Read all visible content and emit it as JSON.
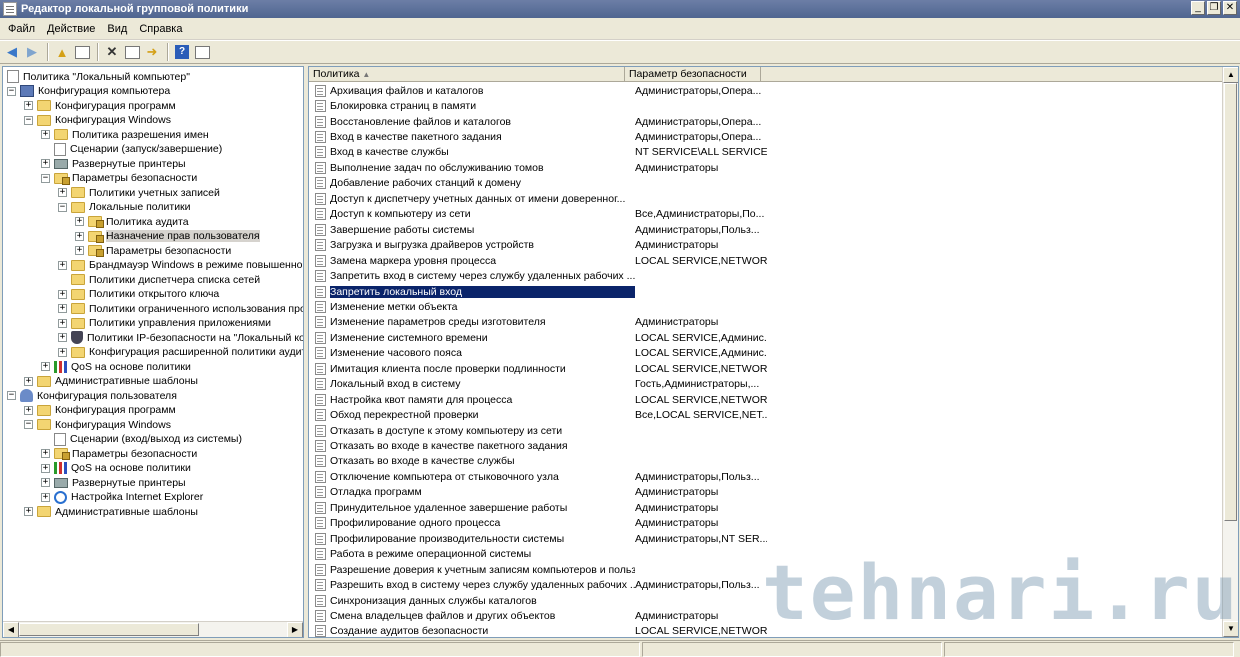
{
  "window": {
    "title": "Редактор локальной групповой политики",
    "controls": [
      "_",
      "❐",
      "✕"
    ]
  },
  "menu": [
    "Файл",
    "Действие",
    "Вид",
    "Справка"
  ],
  "toolbar": [
    "back-icon",
    "forward-icon",
    "up-icon",
    "show-hide-tree-icon",
    "delete-icon",
    "properties-icon",
    "export-icon",
    "help-icon",
    "console-icon"
  ],
  "tree": [
    {
      "label": "Политика \"Локальный компьютер\"",
      "level": 0,
      "exp": "",
      "icon": "doc"
    },
    {
      "label": "Конфигурация компьютера",
      "level": 0,
      "exp": "−",
      "icon": "pc"
    },
    {
      "label": "Конфигурация программ",
      "level": 1,
      "exp": "+",
      "icon": "folder"
    },
    {
      "label": "Конфигурация Windows",
      "level": 1,
      "exp": "−",
      "icon": "folder"
    },
    {
      "label": "Политика разрешения имен",
      "level": 2,
      "exp": "+",
      "icon": "folder"
    },
    {
      "label": "Сценарии (запуск/завершение)",
      "level": 2,
      "exp": "",
      "icon": "doc"
    },
    {
      "label": "Развернутые принтеры",
      "level": 2,
      "exp": "+",
      "icon": "printer"
    },
    {
      "label": "Параметры безопасности",
      "level": 2,
      "exp": "−",
      "icon": "folder-lock"
    },
    {
      "label": "Политики учетных записей",
      "level": 3,
      "exp": "+",
      "icon": "folder"
    },
    {
      "label": "Локальные политики",
      "level": 3,
      "exp": "−",
      "icon": "folder"
    },
    {
      "label": "Политика аудита",
      "level": 4,
      "exp": "+",
      "icon": "folder-lock"
    },
    {
      "label": "Назначение прав пользователя",
      "level": 4,
      "exp": "+",
      "icon": "folder-lock",
      "selected": true
    },
    {
      "label": "Параметры безопасности",
      "level": 4,
      "exp": "+",
      "icon": "folder-lock"
    },
    {
      "label": "Брандмауэр Windows в режиме повышенной б",
      "level": 3,
      "exp": "+",
      "icon": "folder"
    },
    {
      "label": "Политики диспетчера списка сетей",
      "level": 3,
      "exp": "",
      "icon": "folder"
    },
    {
      "label": "Политики открытого ключа",
      "level": 3,
      "exp": "+",
      "icon": "folder"
    },
    {
      "label": "Политики ограниченного использования прог",
      "level": 3,
      "exp": "+",
      "icon": "folder"
    },
    {
      "label": "Политики управления приложениями",
      "level": 3,
      "exp": "+",
      "icon": "folder"
    },
    {
      "label": "Политики IP-безопасности на \"Локальный ког",
      "level": 3,
      "exp": "+",
      "icon": "shield"
    },
    {
      "label": "Конфигурация расширенной политики аудита",
      "level": 3,
      "exp": "+",
      "icon": "folder"
    },
    {
      "label": "QoS на основе политики",
      "level": 2,
      "exp": "+",
      "icon": "chart"
    },
    {
      "label": "Административные шаблоны",
      "level": 1,
      "exp": "+",
      "icon": "folder"
    },
    {
      "label": "Конфигурация пользователя",
      "level": 0,
      "exp": "−",
      "icon": "user"
    },
    {
      "label": "Конфигурация программ",
      "level": 1,
      "exp": "+",
      "icon": "folder"
    },
    {
      "label": "Конфигурация Windows",
      "level": 1,
      "exp": "−",
      "icon": "folder"
    },
    {
      "label": "Сценарии (вход/выход из системы)",
      "level": 2,
      "exp": "",
      "icon": "doc"
    },
    {
      "label": "Параметры безопасности",
      "level": 2,
      "exp": "+",
      "icon": "folder-lock"
    },
    {
      "label": "QoS на основе политики",
      "level": 2,
      "exp": "+",
      "icon": "chart"
    },
    {
      "label": "Развернутые принтеры",
      "level": 2,
      "exp": "+",
      "icon": "printer"
    },
    {
      "label": "Настройка Internet Explorer",
      "level": 2,
      "exp": "+",
      "icon": "ie"
    },
    {
      "label": "Административные шаблоны",
      "level": 1,
      "exp": "+",
      "icon": "folder"
    }
  ],
  "columns": {
    "policy": "Политика",
    "setting": "Параметр безопасности"
  },
  "policies": [
    {
      "name": "Архивация файлов и каталогов",
      "value": "Администраторы,Опера..."
    },
    {
      "name": "Блокировка страниц в памяти",
      "value": ""
    },
    {
      "name": "Восстановление файлов и каталогов",
      "value": "Администраторы,Опера..."
    },
    {
      "name": "Вход в качестве пакетного задания",
      "value": "Администраторы,Опера..."
    },
    {
      "name": "Вход в качестве службы",
      "value": "NT SERVICE\\ALL SERVICES"
    },
    {
      "name": "Выполнение задач по обслуживанию томов",
      "value": "Администраторы"
    },
    {
      "name": "Добавление рабочих станций к домену",
      "value": ""
    },
    {
      "name": "Доступ к диспетчеру учетных данных от имени доверенног...",
      "value": ""
    },
    {
      "name": "Доступ к компьютеру из сети",
      "value": "Все,Администраторы,По..."
    },
    {
      "name": "Завершение работы системы",
      "value": "Администраторы,Польз..."
    },
    {
      "name": "Загрузка и выгрузка драйверов устройств",
      "value": "Администраторы"
    },
    {
      "name": "Замена маркера уровня процесса",
      "value": "LOCAL SERVICE,NETWOR..."
    },
    {
      "name": "Запретить вход в систему через службу удаленных рабочих ...",
      "value": ""
    },
    {
      "name": "Запретить локальный вход",
      "value": "",
      "selected": true
    },
    {
      "name": "Изменение метки объекта",
      "value": ""
    },
    {
      "name": "Изменение параметров среды изготовителя",
      "value": "Администраторы"
    },
    {
      "name": "Изменение системного времени",
      "value": "LOCAL SERVICE,Админис..."
    },
    {
      "name": "Изменение часового пояса",
      "value": "LOCAL SERVICE,Админис..."
    },
    {
      "name": "Имитация клиента после проверки подлинности",
      "value": "LOCAL SERVICE,NETWOR..."
    },
    {
      "name": "Локальный вход в систему",
      "value": "Гость,Администраторы,..."
    },
    {
      "name": "Настройка квот памяти для процесса",
      "value": "LOCAL SERVICE,NETWOR..."
    },
    {
      "name": "Обход перекрестной проверки",
      "value": "Все,LOCAL SERVICE,NET..."
    },
    {
      "name": "Отказать в доступе к этому компьютеру из сети",
      "value": ""
    },
    {
      "name": "Отказать во входе в качестве пакетного задания",
      "value": ""
    },
    {
      "name": "Отказать во входе в качестве службы",
      "value": ""
    },
    {
      "name": "Отключение компьютера от стыковочного узла",
      "value": "Администраторы,Польз..."
    },
    {
      "name": "Отладка программ",
      "value": "Администраторы"
    },
    {
      "name": "Принудительное удаленное завершение работы",
      "value": "Администраторы"
    },
    {
      "name": "Профилирование одного процесса",
      "value": "Администраторы"
    },
    {
      "name": "Профилирование производительности системы",
      "value": "Администраторы,NT SER..."
    },
    {
      "name": "Работа в режиме операционной системы",
      "value": ""
    },
    {
      "name": "Разрешение доверия к учетным записям компьютеров и польз...",
      "value": ""
    },
    {
      "name": "Разрешить вход в систему через службу удаленных рабочих ...",
      "value": "Администраторы,Польз..."
    },
    {
      "name": "Синхронизация данных службы каталогов",
      "value": ""
    },
    {
      "name": "Смена владельцев файлов и других объектов",
      "value": "Администраторы"
    },
    {
      "name": "Создание аудитов безопасности",
      "value": "LOCAL SERVICE,NETWOR..."
    }
  ],
  "watermark": "tehnari.ru"
}
